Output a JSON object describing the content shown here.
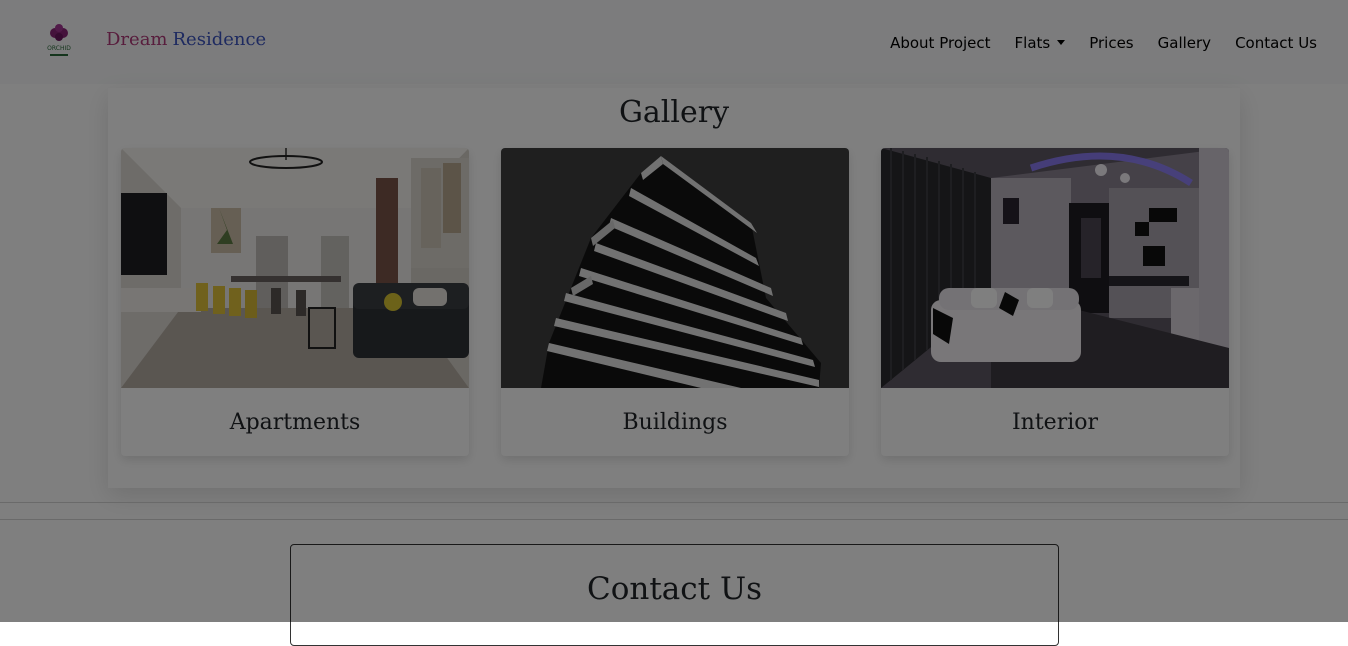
{
  "brand": {
    "logo_text": "ORCHID",
    "name_part1": "Dream",
    "name_part2": "Residence"
  },
  "nav": {
    "about": "About Project",
    "flats": "Flats",
    "prices": "Prices",
    "gallery": "Gallery",
    "contact": "Contact Us"
  },
  "gallery": {
    "title": "Gallery",
    "cards": [
      {
        "label": "Apartments"
      },
      {
        "label": "Buildings"
      },
      {
        "label": "Interior"
      }
    ]
  },
  "contact": {
    "title": "Contact Us"
  },
  "colors": {
    "brand_pink": "#b03a7a",
    "brand_blue": "#3c55c0",
    "backdrop": "rgba(0,0,0,0.5)"
  }
}
